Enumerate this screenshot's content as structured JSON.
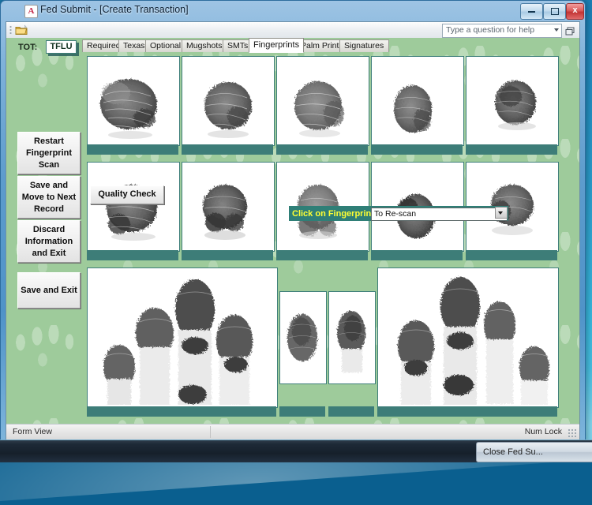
{
  "window": {
    "title": "Fed Submit - [Create Transaction]",
    "app_icon": "access-a-icon",
    "minimize_label": "Minimize",
    "maximize_label": "Maximize",
    "close_label": "x"
  },
  "toolbar": {
    "open_icon": "open-folder-icon",
    "help_placeholder": "Type a question for help",
    "help_value": "Type a question for help",
    "help_dropdown_icon": "chevron-down-icon",
    "restore_icon": "restore-window-icon"
  },
  "sidebar": {
    "tot_label": "TOT:",
    "tot_value": "TFLU",
    "buttons": [
      {
        "label": "Restart Fingerprint Scan"
      },
      {
        "label": "Save and Move to Next Record"
      },
      {
        "label": "Discard Information and Exit"
      },
      {
        "label": "Save and Exit"
      }
    ]
  },
  "tabs": [
    {
      "label": "Required",
      "active": false
    },
    {
      "label": "Texas",
      "active": false
    },
    {
      "label": "Optional",
      "active": false
    },
    {
      "label": "Mugshots",
      "active": false
    },
    {
      "label": "SMTs",
      "active": false
    },
    {
      "label": "Fingerprints",
      "active": true
    },
    {
      "label": "Palm Prints",
      "active": false
    },
    {
      "label": "Signatures",
      "active": false
    }
  ],
  "fingerprints": {
    "row1": [
      {
        "name": "right-thumb"
      },
      {
        "name": "right-index"
      },
      {
        "name": "right-middle"
      },
      {
        "name": "right-ring"
      },
      {
        "name": "right-little"
      }
    ],
    "row2": [
      {
        "name": "left-thumb"
      },
      {
        "name": "left-index"
      },
      {
        "name": "left-middle"
      },
      {
        "name": "left-ring"
      },
      {
        "name": "left-little"
      }
    ],
    "slaps": [
      {
        "name": "left-four-finger-slap"
      },
      {
        "name": "left-thumb-slap"
      },
      {
        "name": "right-thumb-slap"
      },
      {
        "name": "right-four-finger-slap"
      }
    ]
  },
  "controls": {
    "quality_check_label": "Quality Check",
    "click_on_fingerprints_label": "Click on Fingerprints:",
    "rescan_value": "To Re-scan",
    "rescan_arrow_icon": "chevron-down-icon"
  },
  "statusbar": {
    "left": "Form View",
    "right": "Num Lock",
    "grip_icon": "resize-grip-icon"
  },
  "taskbar": {
    "buttons": [
      {
        "label": "Close Fed Su..."
      }
    ]
  },
  "colors": {
    "form_green": "#9ecb9b",
    "panel_teal": "#3d7d78",
    "accent_yellow": "#ffff33",
    "titlebar_blue": "#5d9ccd"
  }
}
